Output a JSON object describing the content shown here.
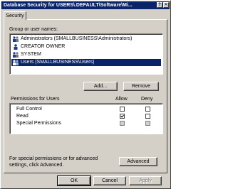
{
  "window": {
    "title": "Database Security for USERS\\.DEFAULT\\Software\\Mi..."
  },
  "titlebar": {
    "help_label": "?",
    "close_label": "✕"
  },
  "tabs": [
    {
      "label": "Security"
    }
  ],
  "group_list": {
    "label": "Group or user names:",
    "items": [
      {
        "label": "Administrators (SMALLBUSINESS\\Administrators)",
        "icon": "group-icon",
        "selected": false
      },
      {
        "label": "CREATOR OWNER",
        "icon": "user-icon",
        "selected": false
      },
      {
        "label": "SYSTEM",
        "icon": "group-icon",
        "selected": false
      },
      {
        "label": "Users (SMALLBUSINESS\\Users)",
        "icon": "group-icon",
        "selected": true
      }
    ]
  },
  "buttons": {
    "add": "Add...",
    "remove": "Remove",
    "advanced": "Advanced",
    "ok": "OK",
    "cancel": "Cancel",
    "apply": "Apply"
  },
  "permissions": {
    "label": "Permissions for Users",
    "allow_header": "Allow",
    "deny_header": "Deny",
    "rows": [
      {
        "name": "Full Control",
        "allow": false,
        "deny": false
      },
      {
        "name": "Read",
        "allow": true,
        "deny": false
      },
      {
        "name": "Special Permissions",
        "allow": false,
        "deny": false
      }
    ]
  },
  "info_text": "For special permissions or for advanced settings, click Advanced."
}
